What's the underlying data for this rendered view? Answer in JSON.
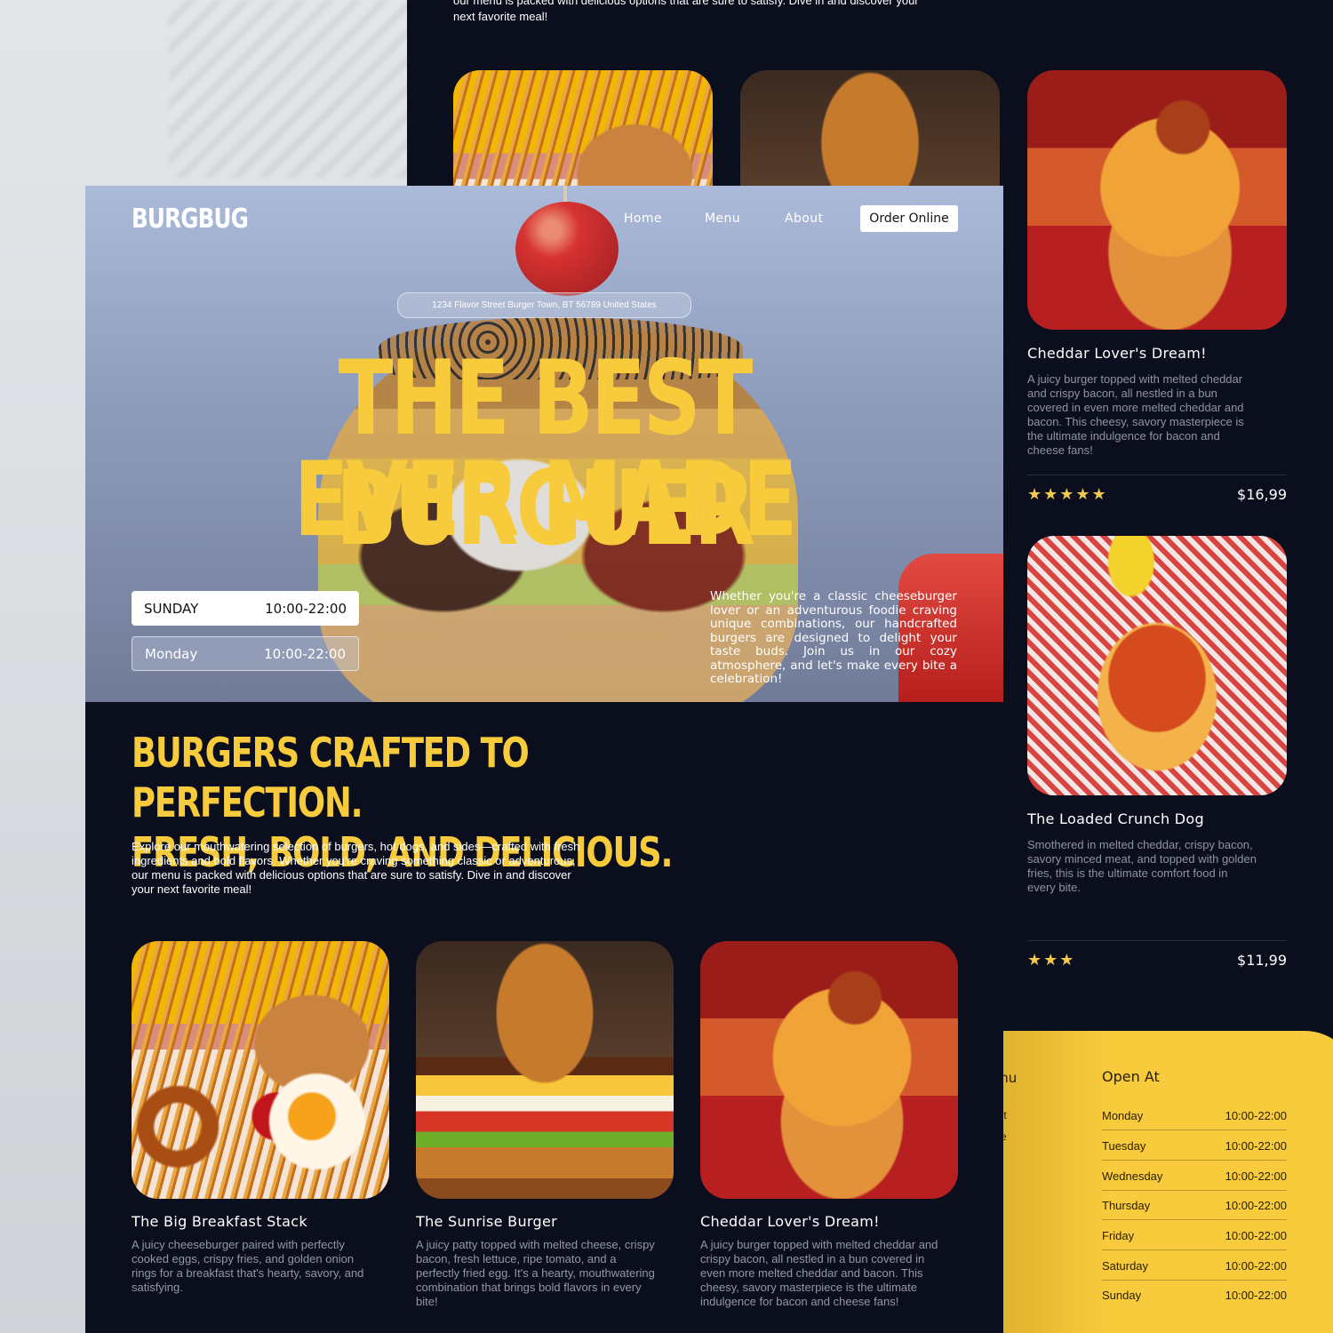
{
  "brand": {
    "logo": "BURGBUG",
    "accent": "#f7cb3c",
    "background": "#0b0e1d"
  },
  "nav": {
    "home": "Home",
    "menu": "Menu",
    "about": "About",
    "order": "Order Online"
  },
  "hero": {
    "address": "1234 Flavor Street Burger Town, BT 56789 United States",
    "headline_line1": "THE BEST BURGUER",
    "headline_line2": "EVER MADE",
    "hours": [
      {
        "day": "SUNDAY",
        "time": "10:00-22:00"
      },
      {
        "day": "Monday",
        "time": "10:00-22:00"
      }
    ],
    "blurb": "Whether you're a classic cheeseburger lover or an adventurous foodie craving unique combinations, our handcrafted burgers are designed to delight your taste buds. Join us in our cozy atmosphere, and let's make every bite a celebration!"
  },
  "section": {
    "title_line1": "BURGERS CRAFTED TO PERFECTION.",
    "title_line2": "FRESH, BOLD, AND DELICIOUS.",
    "description": "Explore our mouthwatering selection of burgers, hot dogs, and sides—crafted with fresh ingredients and bold flavors. Whether you're craving something classic or adventurous, our menu is packed with delicious options that are sure to satisfy. Dive in and discover your next favorite meal!"
  },
  "back_top_text": "our menu is packed with delicious options that are sure to satisfy. Dive in and discover your next favorite meal!",
  "cards": [
    {
      "title": "The Big Breakfast Stack",
      "description": "A juicy cheeseburger paired with perfectly cooked eggs, crispy fries, and golden onion rings for a breakfast that's hearty, savory, and satisfying."
    },
    {
      "title": "The Sunrise Burger",
      "description": "A juicy patty topped with melted cheese, crispy bacon, fresh lettuce, ripe tomato, and a perfectly fried egg. It's a hearty, mouthwatering combination that brings bold flavors in every bite!"
    },
    {
      "title": "Cheddar Lover's Dream!",
      "description": "A juicy burger topped with melted cheddar and crispy bacon, all nestled in a bun covered in even more melted cheddar and bacon. This cheesy, savory masterpiece is the ultimate indulgence for bacon and cheese fans!"
    }
  ],
  "side_items": [
    {
      "title": "Cheddar Lover's Dream!",
      "description": "A juicy burger topped with melted cheddar and crispy bacon, all nestled in a bun covered in even more melted cheddar and bacon. This cheesy, savory masterpiece is the ultimate indulgence for bacon and cheese fans!",
      "stars": "★★★★★",
      "rating": 5,
      "price": "$16,99"
    },
    {
      "title": "The Loaded Crunch Dog",
      "description": "Smothered in melted cheddar, crispy bacon, savory minced meat, and topped with golden fries, this is the ultimate comfort food in every bite.",
      "stars": "★★★",
      "rating": 3,
      "price": "$11,99"
    }
  ],
  "footer": {
    "menu_title": "enu",
    "menu_links": [
      "out",
      "me"
    ],
    "open_title": "Open At",
    "schedule": [
      {
        "day": "Monday",
        "time": "10:00-22:00"
      },
      {
        "day": "Tuesday",
        "time": "10:00-22:00"
      },
      {
        "day": "Wednesday",
        "time": "10:00-22:00"
      },
      {
        "day": "Thursday",
        "time": "10:00-22:00"
      },
      {
        "day": "Friday",
        "time": "10:00-22:00"
      },
      {
        "day": "Saturday",
        "time": "10:00-22:00"
      },
      {
        "day": "Sunday",
        "time": "10:00-22:00"
      }
    ]
  }
}
